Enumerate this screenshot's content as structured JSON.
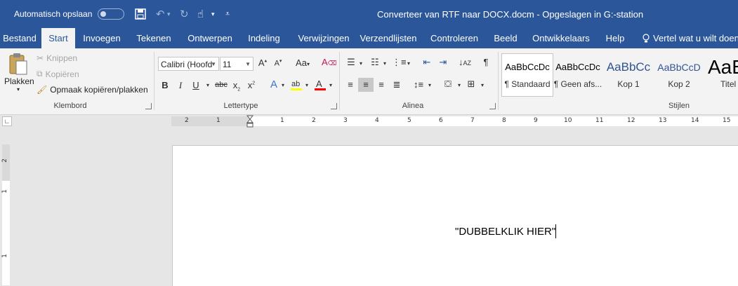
{
  "titlebar": {
    "autosave_label": "Automatisch opslaan",
    "document_title": "Converteer van RTF naar DOCX.docm  -  Opgeslagen in G:-station"
  },
  "tabs": [
    "Bestand",
    "Start",
    "Invoegen",
    "Tekenen",
    "Ontwerpen",
    "Indeling",
    "Verwijzingen",
    "Verzendlijsten",
    "Controleren",
    "Beeld",
    "Ontwikkelaars",
    "Help"
  ],
  "tell_me": "Vertel wat u wilt doen",
  "clipboard": {
    "paste": "Plakken",
    "cut": "Knippen",
    "copy": "Kopiëren",
    "format_painter": "Opmaak kopiëren/plakken",
    "group": "Klembord"
  },
  "font": {
    "name": "Calibri (Hoofd",
    "size": "11",
    "group": "Lettertype"
  },
  "paragraph": {
    "group": "Alinea"
  },
  "styles": {
    "items": [
      {
        "preview": "AaBbCcDc",
        "name": "¶ Standaard"
      },
      {
        "preview": "AaBbCcDc",
        "name": "¶ Geen afs..."
      },
      {
        "preview": "AaBbCc",
        "name": "Kop 1"
      },
      {
        "preview": "AaBbCcD",
        "name": "Kop 2"
      },
      {
        "preview": "AaB",
        "name": "Titel"
      }
    ],
    "group": "Stijlen"
  },
  "ruler": {
    "h_left": [
      "2",
      "1"
    ],
    "h_right": [
      "1",
      "2",
      "3",
      "4",
      "5",
      "6",
      "7",
      "8",
      "9",
      "10",
      "11",
      "12",
      "13",
      "14",
      "15"
    ],
    "v": [
      "2",
      "1",
      "1"
    ]
  },
  "document": {
    "text": "\"DUBBELKLIK HIER\""
  },
  "colors": {
    "accent": "#2b579a",
    "ribbon": "#f3f3f3",
    "highlight": "#ffff00",
    "font_color": "#ff0000"
  }
}
